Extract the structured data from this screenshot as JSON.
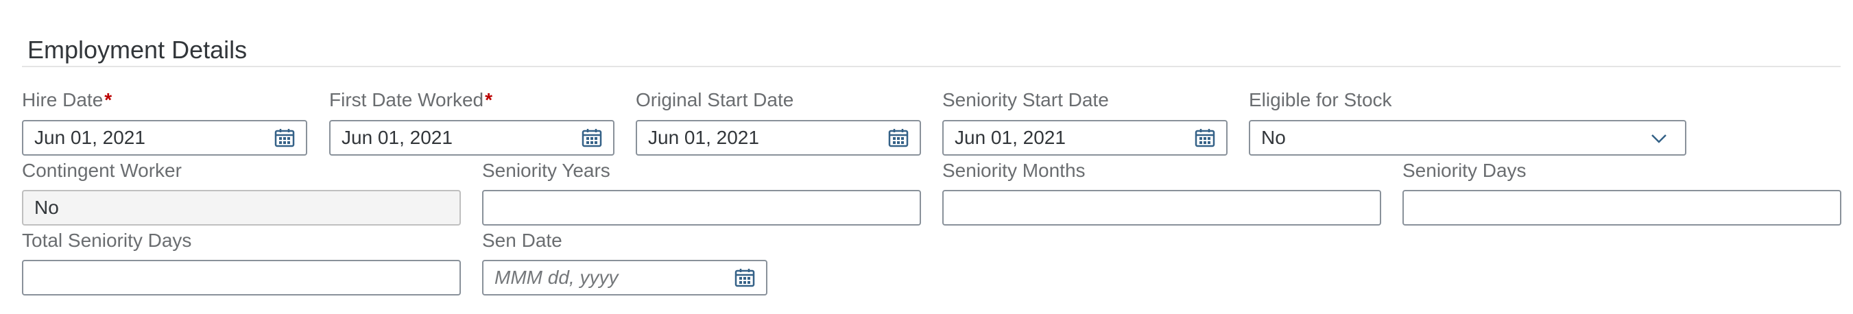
{
  "section": {
    "title": "Employment Details"
  },
  "fields": {
    "hire_date": {
      "label": "Hire Date",
      "required": "*",
      "value": "Jun 01, 2021",
      "icon": "calendar-icon"
    },
    "first_date_worked": {
      "label": "First Date Worked",
      "required": "*",
      "value": "Jun 01, 2021",
      "icon": "calendar-icon"
    },
    "original_start_date": {
      "label": "Original Start Date",
      "value": "Jun 01, 2021",
      "icon": "calendar-icon"
    },
    "seniority_start_date": {
      "label": "Seniority Start Date",
      "value": "Jun 01, 2021",
      "icon": "calendar-icon"
    },
    "eligible_for_stock": {
      "label": "Eligible for Stock",
      "value": "No",
      "icon": "chevron-down-icon"
    },
    "contingent_worker": {
      "label": "Contingent Worker",
      "value": "No"
    },
    "seniority_years": {
      "label": "Seniority Years",
      "value": ""
    },
    "seniority_months": {
      "label": "Seniority Months",
      "value": ""
    },
    "seniority_days": {
      "label": "Seniority Days",
      "value": ""
    },
    "total_seniority_days": {
      "label": "Total Seniority Days",
      "value": ""
    },
    "sen_date": {
      "label": "Sen Date",
      "value": "",
      "placeholder": "MMM dd, yyyy",
      "icon": "calendar-icon"
    }
  },
  "colors": {
    "required": "#bb0000",
    "icon": "#346187",
    "border": "#89919a",
    "readonly_bg": "#f4f4f4"
  }
}
